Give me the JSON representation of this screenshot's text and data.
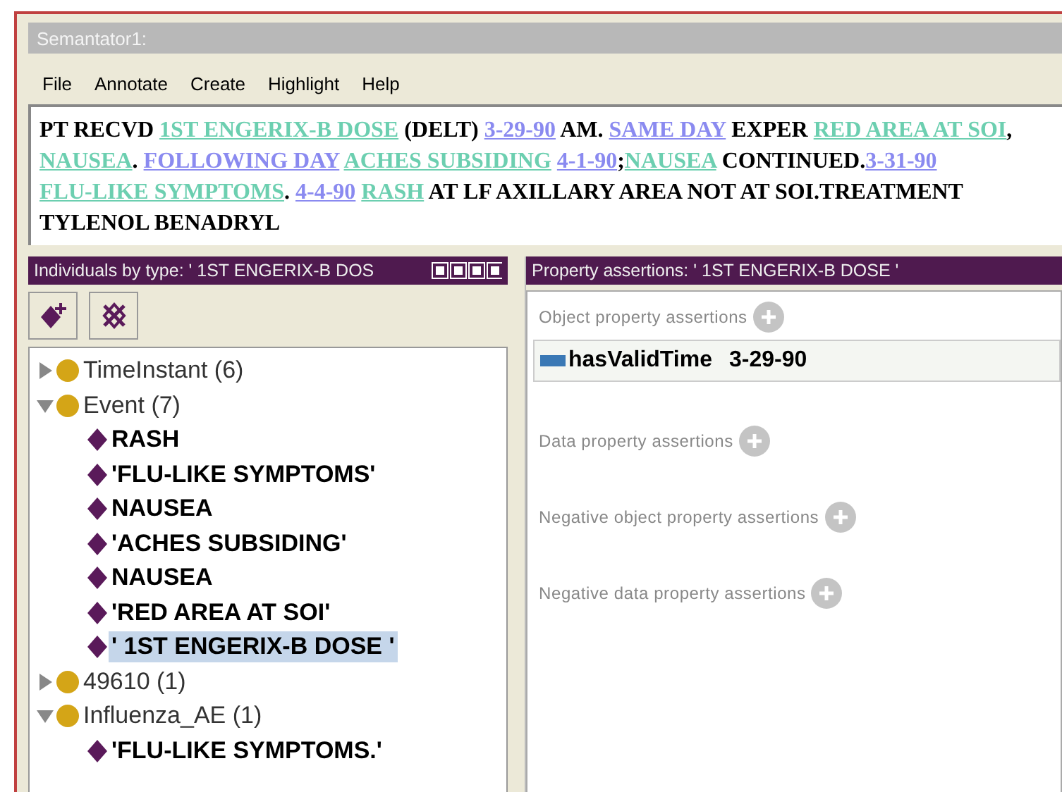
{
  "window": {
    "title": "Semantator1:"
  },
  "menu": [
    "File",
    "Annotate",
    "Create",
    "Highlight",
    "Help"
  ],
  "document": [
    {
      "kind": "plain",
      "text": "PT RECVD "
    },
    {
      "kind": "event",
      "text": "1ST ENGERIX-B DOSE"
    },
    {
      "kind": "plain",
      "text": " (DELT) "
    },
    {
      "kind": "time",
      "text": "3-29-90"
    },
    {
      "kind": "plain",
      "text": " AM. "
    },
    {
      "kind": "time",
      "text": "SAME DAY"
    },
    {
      "kind": "plain",
      "text": " EXPER "
    },
    {
      "kind": "event",
      "text": "RED AREA AT SOI"
    },
    {
      "kind": "plain",
      "text": ", "
    },
    {
      "kind": "event",
      "text": "NAUSEA"
    },
    {
      "kind": "plain",
      "text": ". "
    },
    {
      "kind": "time",
      "text": "FOLLOWING DAY"
    },
    {
      "kind": "space"
    },
    {
      "kind": "event",
      "text": "ACHES SUBSIDING"
    },
    {
      "kind": "space"
    },
    {
      "kind": "time",
      "text": "4-1-90"
    },
    {
      "kind": "plain",
      "text": ";"
    },
    {
      "kind": "event",
      "text": "NAUSEA"
    },
    {
      "kind": "plain",
      "text": " CONTINUED."
    },
    {
      "kind": "time",
      "text": "3-31-90"
    },
    {
      "kind": "space"
    },
    {
      "kind": "event",
      "text": "FLU-LIKE SYMPTOMS"
    },
    {
      "kind": "plain",
      "text": ". "
    },
    {
      "kind": "time",
      "text": "4-4-90"
    },
    {
      "kind": "space"
    },
    {
      "kind": "event",
      "text": "RASH"
    },
    {
      "kind": "plain",
      "text": " AT LF AXILLARY AREA NOT AT SOI.TREATMENT TYLENOL BENADRYL"
    }
  ],
  "individuals_panel": {
    "title": "Individuals by type: ' 1ST ENGERIX-B DOS",
    "tree": [
      {
        "kind": "class",
        "label": "TimeInstant (6)",
        "expanded": false,
        "selected": false
      },
      {
        "kind": "class",
        "label": "Event (7)",
        "expanded": true,
        "selected": false,
        "children": [
          {
            "kind": "individual",
            "label": "RASH",
            "selected": false
          },
          {
            "kind": "individual",
            "label": "'FLU-LIKE SYMPTOMS'",
            "selected": false
          },
          {
            "kind": "individual",
            "label": "NAUSEA",
            "selected": false
          },
          {
            "kind": "individual",
            "label": "'ACHES SUBSIDING'",
            "selected": false
          },
          {
            "kind": "individual",
            "label": "NAUSEA",
            "selected": false
          },
          {
            "kind": "individual",
            "label": "'RED AREA AT SOI'",
            "selected": false
          },
          {
            "kind": "individual",
            "label": "' 1ST ENGERIX-B DOSE '",
            "selected": true
          }
        ]
      },
      {
        "kind": "class",
        "label": "49610 (1)",
        "expanded": false,
        "selected": false
      },
      {
        "kind": "class",
        "label": "Influenza_AE (1)",
        "expanded": true,
        "selected": false,
        "children": [
          {
            "kind": "individual",
            "label": "'FLU-LIKE SYMPTOMS.'",
            "selected": false
          }
        ]
      }
    ]
  },
  "property_panel": {
    "title": "Property assertions: ' 1ST ENGERIX-B DOSE '",
    "sections": [
      {
        "label": "Object property assertions",
        "assertions": [
          {
            "property": "hasValidTime",
            "value": "3-29-90"
          }
        ]
      },
      {
        "label": "Data property assertions"
      },
      {
        "label": "Negative object property assertions"
      },
      {
        "label": "Negative data property assertions"
      }
    ]
  }
}
